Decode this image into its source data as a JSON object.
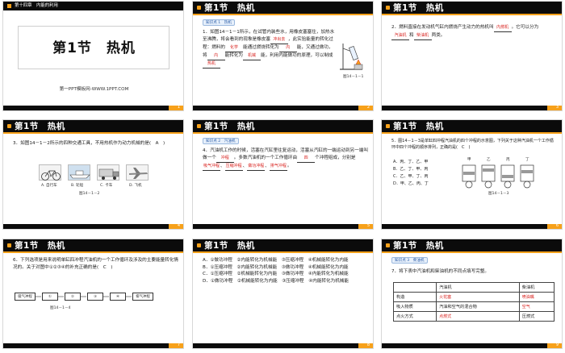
{
  "slides": [
    {
      "number": "1",
      "chapter": "第十四章　内能的利用",
      "title": "第1节　热机",
      "site": "第一PPT模板网-WWW.1PPT.COM"
    },
    {
      "number": "2",
      "header": "第1节　热机",
      "tag": "知识点 1　热机",
      "text1": "1．如图14－1－1所示，在试管内装些水，用橡皮塞塞住，加热水至沸腾，将会看到的现象是橡皮塞",
      "ans1": "冲出去",
      "text2": "，此实验能量的转化过程：燃料的",
      "ans2": "化学",
      "text3": "能通过燃烧转化为",
      "ans3": "内",
      "text4": "能，又通过做功，将",
      "ans4": "内",
      "text5": "能转化为",
      "ans5": "机械",
      "text6": "能，利用内能做功的原理，可以制成",
      "ans6": "热机",
      "fig": "图14－1－1"
    },
    {
      "number": "3",
      "header": "第1节　热机",
      "text1": "2．燃料直接在发动机气缸内燃烧产生动力的热机叫",
      "ans1": "内燃机",
      "text2": "。它可以分为",
      "ans2": "汽油机",
      "text3": "和",
      "ans3": "柴油机",
      "text4": "两类。"
    },
    {
      "number": "4",
      "header": "第1节　热机",
      "text": "3．如图14－1－2所示的四种交通工具，不用热机作为动力机械的是(　A　)",
      "captions": [
        "A. 自行车",
        "B. 轮船",
        "C. 卡车",
        "D. 飞机"
      ],
      "fig": "图14－1－2"
    },
    {
      "number": "5",
      "header": "第1节　热机",
      "tag": "知识点 2　汽油机",
      "text1": "4．汽油机工作的时候，活塞在汽缸里往复运动，活塞从汽缸的一端运动到另一端叫做一个",
      "ans1": "冲程",
      "text2": "。多数汽油机的一个工作循环由",
      "ans2": "四",
      "text3": "个冲程组成，分别是",
      "ans3": "吸气冲程",
      "ans4": "压缩冲程",
      "ans5": "做功冲程",
      "ans6": "排气冲程"
    },
    {
      "number": "6",
      "header": "第1节　热机",
      "text": "5．图14－1－3是单缸四冲程汽油机的四个冲程的示意图，下列关于这种汽油机一个工作循环中四个冲程的顺序排列，正确的是(　C　)",
      "options": [
        "A．丙、丁、乙、甲",
        "B．乙、丁、甲、丙",
        "C．乙、甲、丁、丙",
        "D．甲、乙、丙、丁"
      ],
      "labels": [
        "甲",
        "乙",
        "丙",
        "丁"
      ],
      "fig": "图14－1－3"
    },
    {
      "number": "7",
      "header": "第1节　热机",
      "text": "6．下列选项是用来说明单缸四冲程汽油机的一个工作循环及涉及的主要能量转化情况的。关于对图中①②③④的补充正确的是(　C　)",
      "flow": [
        "吸气冲程",
        "①",
        "②",
        "③",
        "④",
        "排气冲程"
      ],
      "fig": "图14－1－4"
    },
    {
      "number": "8",
      "header": "第1节　热机",
      "options": [
        "A．①做功冲程　②内能转化为机械能　③压缩冲程　④机械能转化为内能",
        "B．①压缩冲程　②内能转化为机械能　③做功冲程　④机械能转化为内能",
        "C．①压缩冲程　②机械能转化为内能　③做功冲程　④内能转化为机械能",
        "D．①做功冲程　②机械能转化为内能　③压缩冲程　④内能转化为机械能"
      ]
    },
    {
      "number": "9",
      "header": "第1节　热机",
      "tag": "知识点 3　柴油机",
      "text": "7．将下表中汽油机和柴油机的不同点填写完整。",
      "table": [
        [
          "",
          "汽油机",
          "柴油机"
        ],
        [
          "构造",
          "火花塞",
          "喷油嘴"
        ],
        [
          "吸入物质",
          "汽油和空气的混合物",
          "空气"
        ],
        [
          "点火方式",
          "点燃式",
          "压燃式"
        ]
      ]
    }
  ]
}
